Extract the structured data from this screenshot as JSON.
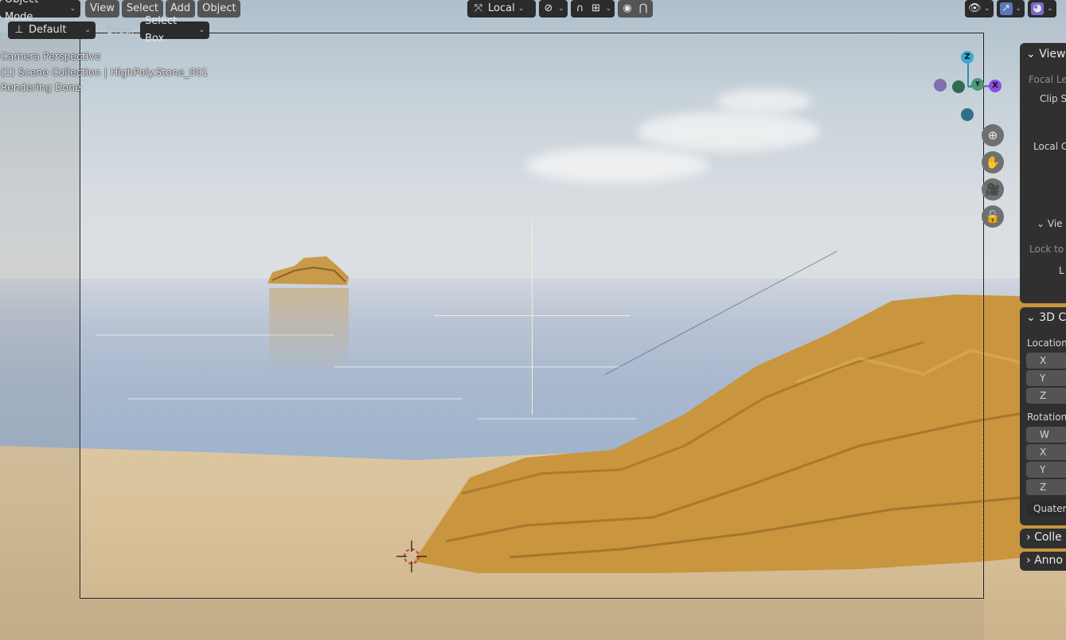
{
  "header": {
    "mode": "Object Mode",
    "menus": [
      "View",
      "Select",
      "Add",
      "Object"
    ],
    "transform_orientation": "Local"
  },
  "toolbar": {
    "orientation_label": "Default",
    "drag_label": "Drag:",
    "drag_value": "Select Box"
  },
  "overlay": {
    "line1": "Camera Perspective",
    "line2": "(1) Scene Collection | HighPoly.Stone_001",
    "line3": "Rendering Done"
  },
  "gizmo": {
    "z": "Z",
    "y": "Y",
    "x": "X"
  },
  "npanel": {
    "view_header": "View",
    "focal": "Focal Le",
    "clip": "Clip S",
    "local": "Local C",
    "view_lock": "Vie",
    "lock_to": "Lock to",
    "lock_l": "L",
    "cursor_header": "3D C",
    "location": "Location",
    "loc_x": "X",
    "loc_y": "Y",
    "loc_z": "Z",
    "rotation": "Rotation",
    "rot_w": "W",
    "rot_x": "X",
    "rot_y": "Y",
    "rot_z": "Z",
    "rotation_mode": "Quater",
    "collections": "Colle",
    "annotations": "Anno"
  }
}
